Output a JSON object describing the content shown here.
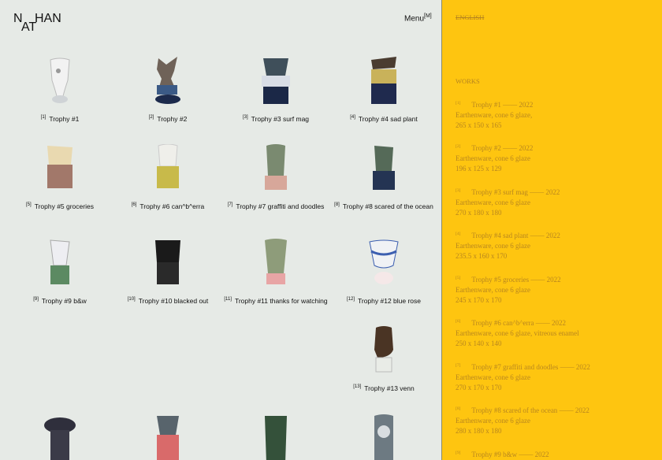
{
  "logo": {
    "l1": "N",
    "l2": "AT",
    "l3": "HAN"
  },
  "menu": {
    "label": "Menu",
    "shortcut": "[M]"
  },
  "language": "ENGLISH",
  "works_heading": "WORKS",
  "gallery": [
    {
      "num": "[1]",
      "title": "Trophy #1"
    },
    {
      "num": "[2]",
      "title": "Trophy #2"
    },
    {
      "num": "[3]",
      "title": "Trophy #3 surf mag"
    },
    {
      "num": "[4]",
      "title": "Trophy #4 sad plant"
    },
    {
      "num": "[5]",
      "title": "Trophy #5 groceries"
    },
    {
      "num": "[6]",
      "title": "Trophy #6 can^b^erra"
    },
    {
      "num": "[7]",
      "title": "Trophy #7 graffiti and doodles"
    },
    {
      "num": "[8]",
      "title": "Trophy #8 scared of the ocean"
    },
    {
      "num": "[9]",
      "title": "Trophy #9 b&w"
    },
    {
      "num": "[10]",
      "title": "Trophy #10 blacked out"
    },
    {
      "num": "[11]",
      "title": "Trophy #11 thanks for watching"
    },
    {
      "num": "[12]",
      "title": "Trophy #12 blue rose"
    },
    {
      "num": "[13]",
      "title": "Trophy #13 venn"
    }
  ],
  "works": [
    {
      "num": "[1]",
      "title": "Trophy #1",
      "year": "2022",
      "material": "Earthenware, cone 6 glaze,",
      "dims": "265 x 150 x 165"
    },
    {
      "num": "[2]",
      "title": "Trophy #2",
      "year": "2022",
      "material": "Earthenware, cone 6 glaze",
      "dims": "196 x 125 x 129"
    },
    {
      "num": "[3]",
      "title": "Trophy #3 surf mag",
      "year": "2022",
      "material": "Earthenware, cone 6 glaze",
      "dims": "270 x 180 x 180"
    },
    {
      "num": "[4]",
      "title": "Trophy #4 sad plant",
      "year": "2022",
      "material": "Earthenware, cone 6 glaze",
      "dims": "235.5 x 160 x 170"
    },
    {
      "num": "[5]",
      "title": "Trophy #5 groceries",
      "year": "2022",
      "material": "Earthenware, cone 6 glaze",
      "dims": "245 x 170 x 170"
    },
    {
      "num": "[6]",
      "title": "Trophy #6 can^b^erra",
      "year": "2022",
      "material": "Earthenware, cone 6 glaze, vitreous enamel",
      "dims": "250 x 140 x 140"
    },
    {
      "num": "[7]",
      "title": "Trophy #7 graffiti and doodles",
      "year": "2022",
      "material": "Earthenware, cone 6 glaze",
      "dims": "270 x 170 x 170"
    },
    {
      "num": "[8]",
      "title": "Trophy #8 scared of the ocean",
      "year": "2022",
      "material": "Earthenware, cone 6 glaze",
      "dims": "280 x 180 x 180"
    },
    {
      "num": "[9]",
      "title": "Trophy #9 b&w",
      "year": "2022"
    }
  ]
}
